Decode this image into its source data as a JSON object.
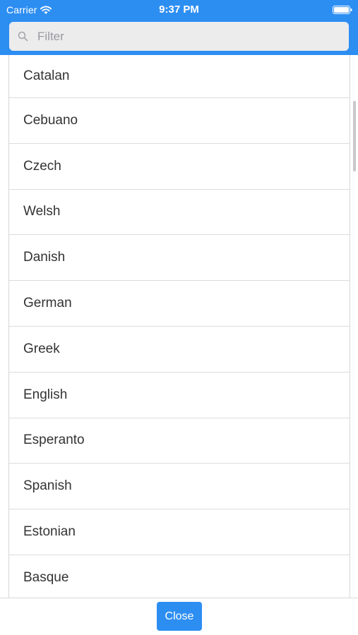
{
  "status_bar": {
    "carrier": "Carrier",
    "time": "9:37 PM"
  },
  "icons": {
    "wifi": "wifi-icon",
    "battery": "battery-icon",
    "search": "search-icon"
  },
  "search": {
    "placeholder": "Filter",
    "value": ""
  },
  "languages": [
    "Catalan",
    "Cebuano",
    "Czech",
    "Welsh",
    "Danish",
    "German",
    "Greek",
    "English",
    "Esperanto",
    "Spanish",
    "Estonian",
    "Basque"
  ],
  "footer": {
    "close_label": "Close"
  },
  "colors": {
    "accent": "#2d8ef2",
    "search_bg": "#ececed",
    "divider": "#dcdcdc",
    "text": "#333333",
    "placeholder": "#9a9aa0"
  }
}
